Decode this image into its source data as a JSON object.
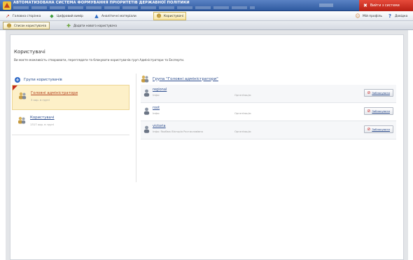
{
  "header": {
    "app_title": "АВТОМАТИЗОВАНА СИСТЕМА ФОРМУВАННЯ ПРІОРИТЕТІВ ДЕРЖАВНОЇ ПОЛІТИКИ",
    "exit_label": "Вийти з системи"
  },
  "nav": {
    "items": [
      {
        "label": "Головна сторінка",
        "icon": "arrow-icon"
      },
      {
        "label": "Цифровий вимір",
        "icon": "digits-icon"
      },
      {
        "label": "Аналітичні матеріали",
        "icon": "analytics-icon"
      },
      {
        "label": "Користувачі",
        "icon": "users-icon",
        "active": true
      }
    ],
    "profile_label": "Мій профіль",
    "help_label": "Довідка"
  },
  "subtabs": {
    "list_label": "Список користувачів",
    "add_label": "Додати нового користувача"
  },
  "page": {
    "title": "Користувачі",
    "description": "Ви маєте можливість створювати, переглядати та блокувати користувачів груп Адміністратори та Експерти."
  },
  "groups": {
    "header": "Групи користувачів",
    "items": [
      {
        "name": "Головні адміністратори",
        "count": "3 кор. в групі",
        "active": true
      },
      {
        "name": "Користувачі",
        "count": "1317 кор. в групі",
        "active": false
      }
    ]
  },
  "group_view": {
    "heading": "Група \"Головні адміністратори\""
  },
  "users": {
    "rows": [
      {
        "login": "regional",
        "info": "Інфо:",
        "org": "Організація:",
        "action": "Заблокувати"
      },
      {
        "login": "root",
        "info": "Інфо:",
        "org": "Організація:",
        "action": "Заблокувати"
      },
      {
        "login": "victoria",
        "info": "Інфо: Якобюк Вікторія Ростиславівна",
        "org": "Організація:",
        "action": "Заблокувати"
      }
    ]
  },
  "colors": {
    "topbar": "#2f5aa0",
    "exit": "#c72a1c",
    "active_tab": "#f7e4a4",
    "link": "#2f4f8f"
  }
}
